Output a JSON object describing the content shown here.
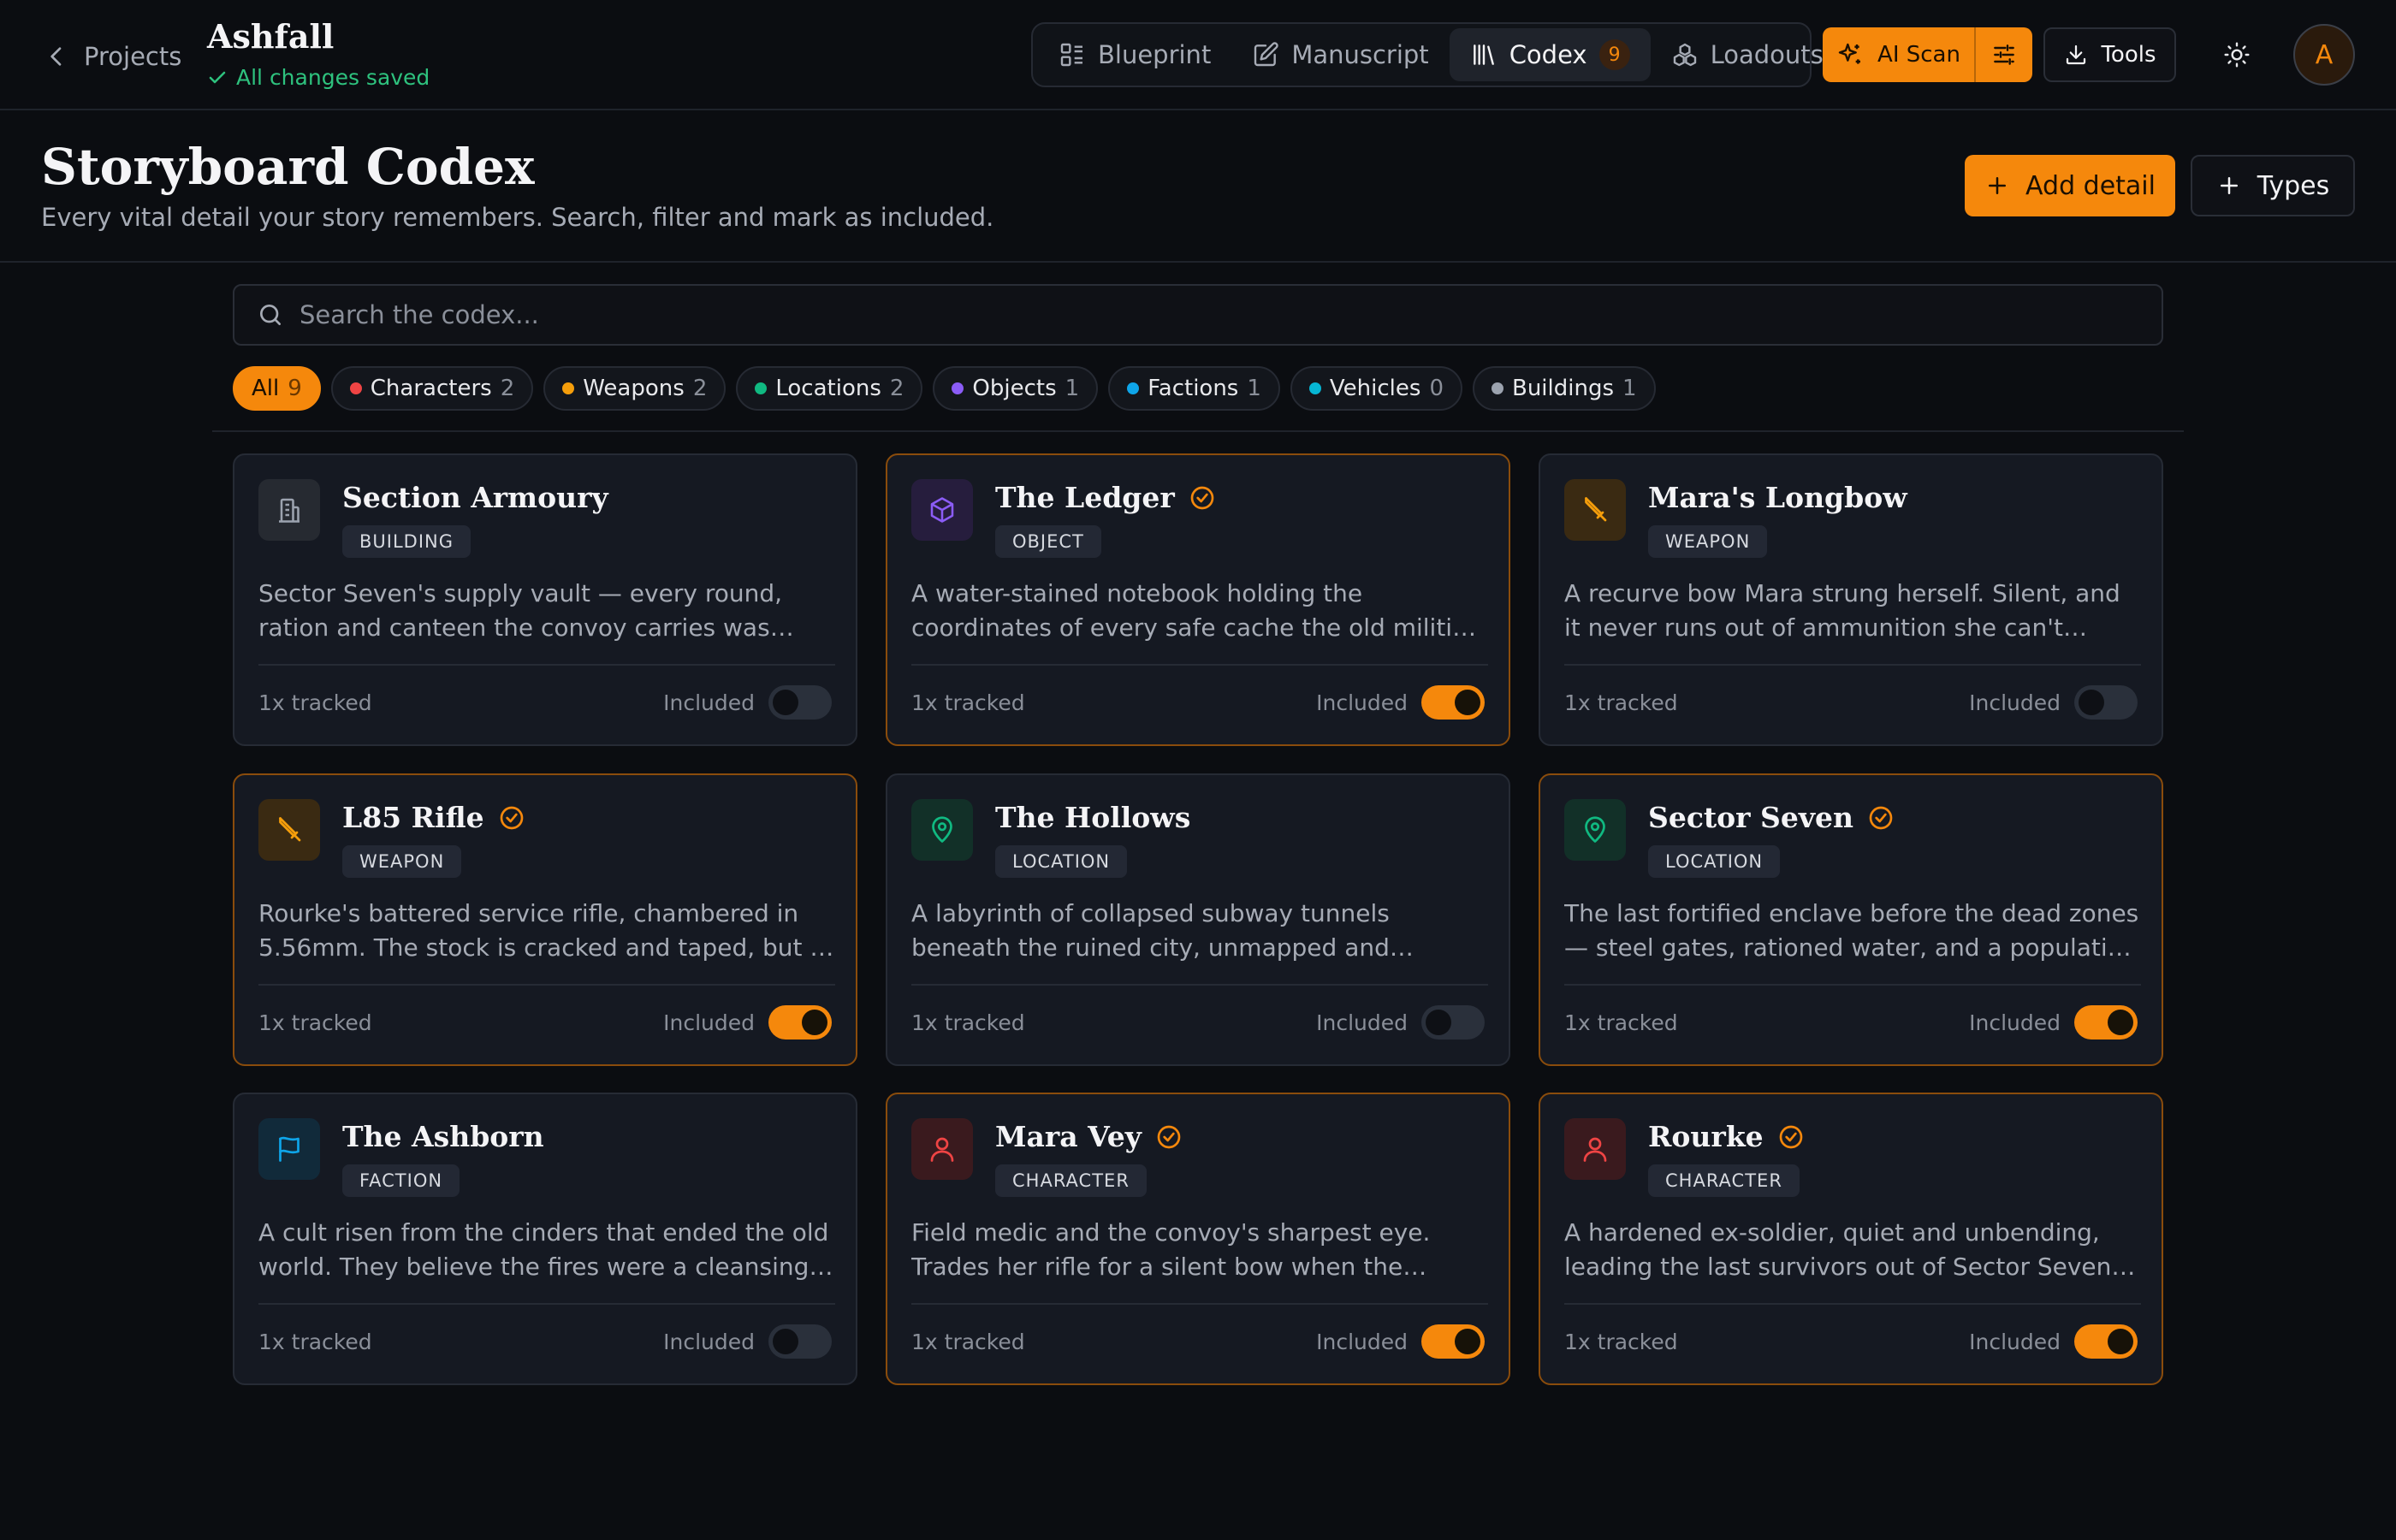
{
  "topbar": {
    "back_label": "Projects",
    "project_title": "Ashfall",
    "save_status": "All changes saved",
    "tabs": [
      {
        "label": "Blueprint",
        "icon": "blueprint-icon"
      },
      {
        "label": "Manuscript",
        "icon": "pencil-icon"
      },
      {
        "label": "Codex",
        "icon": "library-icon",
        "count": "9",
        "active": true
      },
      {
        "label": "Loadouts",
        "icon": "loadouts-icon"
      }
    ],
    "ai_scan_label": "AI Scan",
    "tools_label": "Tools",
    "avatar_initial": "A"
  },
  "header": {
    "title": "Storyboard Codex",
    "subtitle": "Every vital detail your story remembers. Search, filter and mark as included.",
    "add_label": "Add detail",
    "types_label": "Types"
  },
  "search": {
    "placeholder": "Search the codex..."
  },
  "filters": [
    {
      "label": "All",
      "count": "9",
      "active": true,
      "color": ""
    },
    {
      "label": "Characters",
      "count": "2",
      "color": "#ef4444"
    },
    {
      "label": "Weapons",
      "count": "2",
      "color": "#f59e0b"
    },
    {
      "label": "Locations",
      "count": "2",
      "color": "#10b981"
    },
    {
      "label": "Objects",
      "count": "1",
      "color": "#8b5cf6"
    },
    {
      "label": "Factions",
      "count": "1",
      "color": "#0ea5e9"
    },
    {
      "label": "Vehicles",
      "count": "0",
      "color": "#06b6d4"
    },
    {
      "label": "Buildings",
      "count": "1",
      "color": "#9ca3af"
    }
  ],
  "colors": {
    "accent": "#f5880c",
    "saved": "#2ec27e"
  },
  "cards": [
    {
      "title": "Section Armoury",
      "type": "BUILDING",
      "icon": "building-icon",
      "icon_color": "#9ca3af",
      "icon_bg": "#262a31",
      "verified": false,
      "desc": "Sector Seven's supply vault — every round, ration and canteen the convoy carries was drawn from its shelves.",
      "tracked": "1x tracked",
      "included_label": "Included",
      "included": false
    },
    {
      "title": "The Ledger",
      "type": "OBJECT",
      "icon": "cube-icon",
      "icon_color": "#8b5cf6",
      "icon_bg": "#261d3d",
      "verified": true,
      "desc": "A water-stained notebook holding the coordinates of every safe cache the old militia ever buried.",
      "tracked": "1x tracked",
      "included_label": "Included",
      "included": true
    },
    {
      "title": "Mara's Longbow",
      "type": "WEAPON",
      "icon": "sword-icon",
      "icon_color": "#f59e0b",
      "icon_bg": "#3a2a12",
      "verified": false,
      "desc": "A recurve bow Mara strung herself. Silent, and it never runs out of ammunition she can't recover.",
      "tracked": "1x tracked",
      "included_label": "Included",
      "included": false
    },
    {
      "title": "L85 Rifle",
      "type": "WEAPON",
      "icon": "sword-icon",
      "icon_color": "#f59e0b",
      "icon_bg": "#3a2a12",
      "verified": true,
      "desc": "Rourke's battered service rifle, chambered in 5.56mm. The stock is cracked and taped, but it has never jammed.",
      "tracked": "1x tracked",
      "included_label": "Included",
      "included": true
    },
    {
      "title": "The Hollows",
      "type": "LOCATION",
      "icon": "map-pin-icon",
      "icon_color": "#10b981",
      "icon_bg": "#123028",
      "verified": false,
      "desc": "A labyrinth of collapsed subway tunnels beneath the ruined city, unmapped and lightless.",
      "tracked": "1x tracked",
      "included_label": "Included",
      "included": false
    },
    {
      "title": "Sector Seven",
      "type": "LOCATION",
      "icon": "map-pin-icon",
      "icon_color": "#10b981",
      "icon_bg": "#123028",
      "verified": true,
      "desc": "The last fortified enclave before the dead zones — steel gates, rationed water, and a population holding its breath.",
      "tracked": "1x tracked",
      "included_label": "Included",
      "included": true
    },
    {
      "title": "The Ashborn",
      "type": "FACTION",
      "icon": "flag-icon",
      "icon_color": "#0ea5e9",
      "icon_bg": "#112a3a",
      "verified": false,
      "desc": "A cult risen from the cinders that ended the old world. They believe the fires were a cleansing and seek to finish them.",
      "tracked": "1x tracked",
      "included_label": "Included",
      "included": false
    },
    {
      "title": "Mara Vey",
      "type": "CHARACTER",
      "icon": "user-icon",
      "icon_color": "#ef4444",
      "icon_bg": "#3a1a1e",
      "verified": true,
      "desc": "Field medic and the convoy's sharpest eye. Trades her rifle for a silent bow when the rounds run low.",
      "tracked": "1x tracked",
      "included_label": "Included",
      "included": true
    },
    {
      "title": "Rourke",
      "type": "CHARACTER",
      "icon": "user-icon",
      "icon_color": "#ef4444",
      "icon_bg": "#3a1a1e",
      "verified": true,
      "desc": "A hardened ex-soldier, quiet and unbending, leading the last survivors out of Sector Seven. Trusts no one.",
      "tracked": "1x tracked",
      "included_label": "Included",
      "included": true
    }
  ]
}
